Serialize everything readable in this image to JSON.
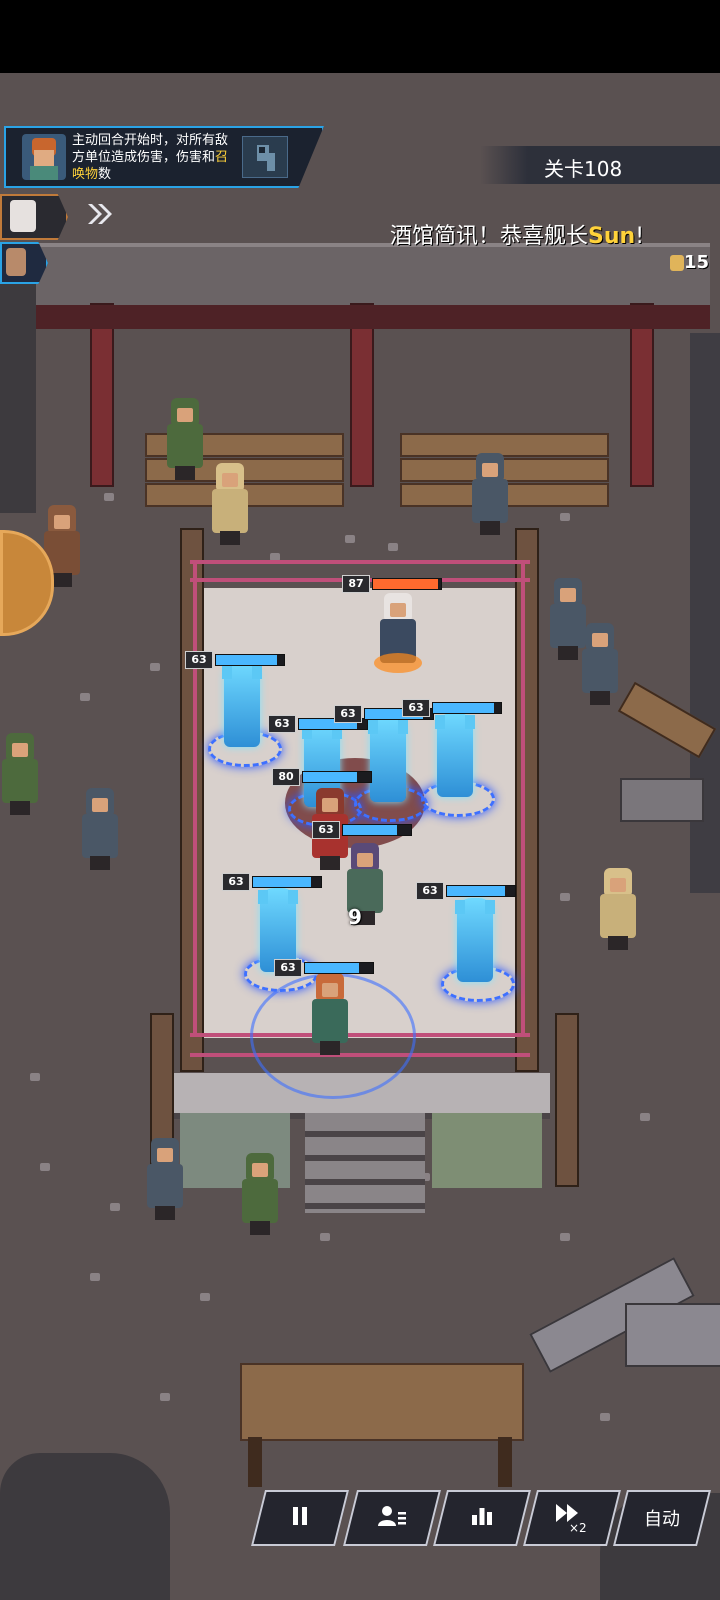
{
  "skill_banner": {
    "text_parts": [
      {
        "t": "主动回合开始时，对所有敌方单位造成伤害，伤害和",
        "hl": false
      },
      {
        "t": "召唤物",
        "hl": true
      },
      {
        "t": "数",
        "hl": false
      }
    ],
    "icon": "wrench-skill-icon"
  },
  "level_label": "关卡108",
  "news_ticker": {
    "prefix": "酒馆简讯！恭喜舰长",
    "name": "Sun",
    "tail": "!",
    "count": "15"
  },
  "arrow_icon": "double-chevron-right-icon",
  "boss_hp": {
    "level": "87",
    "fraction": 0.95
  },
  "units": [
    {
      "level": "63",
      "fraction": 0.9
    },
    {
      "level": "63",
      "fraction": 0.85
    },
    {
      "level": "63",
      "fraction": 0.85
    },
    {
      "level": "63",
      "fraction": 0.9
    },
    {
      "level": "80",
      "fraction": 0.8
    },
    {
      "level": "63",
      "fraction": 0.8
    },
    {
      "level": "63",
      "fraction": 0.85
    },
    {
      "level": "63",
      "fraction": 0.85
    },
    {
      "level": "63",
      "fraction": 0.8
    }
  ],
  "damage_number": "9",
  "controls": {
    "pause_icon": "pause-icon",
    "team_icon": "team-list-icon",
    "stats_icon": "bar-chart-icon",
    "speed_icon": "fast-forward-icon",
    "speed_mult": "×2",
    "auto_label": "自动"
  },
  "colors": {
    "accent": "#2aa3e6",
    "highlight": "#ffd23a",
    "spirit": "#4fc3f7"
  }
}
